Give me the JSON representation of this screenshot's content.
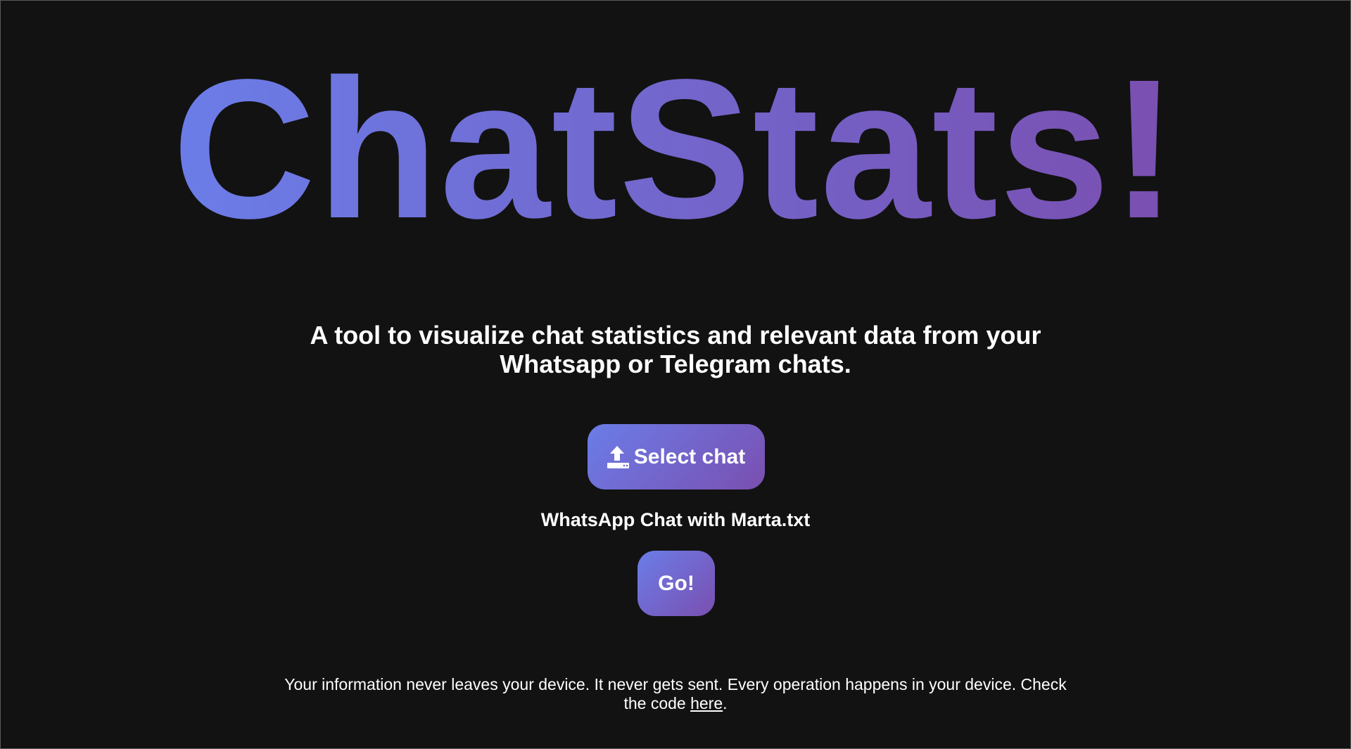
{
  "header": {
    "title": "ChatStats!"
  },
  "main": {
    "subtitle_line1": "A tool to visualize chat statistics and relevant data from your",
    "subtitle_line2": "Whatsapp or Telegram chats.",
    "select_button": {
      "label": "Select chat",
      "icon": "upload-icon"
    },
    "selected_file": "WhatsApp Chat with Marta.txt",
    "go_button": {
      "label": "Go!"
    }
  },
  "footer": {
    "line1": "Your information never leaves your device. It never gets sent. Every operation happens in your device. Check",
    "line2_prefix": "the code ",
    "link_text": "here",
    "line2_suffix": "."
  },
  "colors": {
    "background": "#121212",
    "gradient_start": "#6b7de8",
    "gradient_end": "#7a4fb0",
    "text": "#ffffff"
  }
}
